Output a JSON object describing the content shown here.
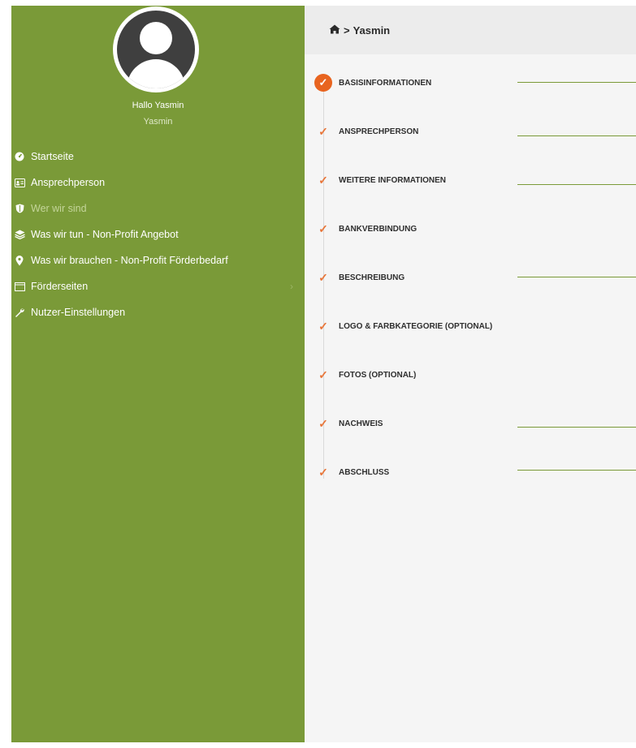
{
  "user": {
    "greeting": "Hallo Yasmin",
    "name": "Yasmin"
  },
  "sidebar": {
    "items": [
      {
        "label": "Startseite",
        "icon": "dashboard-icon"
      },
      {
        "label": "Ansprechperson",
        "icon": "id-card-icon"
      },
      {
        "label": "Wer wir sind",
        "icon": "shield-icon"
      },
      {
        "label": "Was wir tun - Non-Profit Angebot",
        "icon": "layers-icon"
      },
      {
        "label": "Was wir brauchen - Non-Profit Förderbedarf",
        "icon": "map-pin-icon"
      },
      {
        "label": "Förderseiten",
        "icon": "window-icon"
      },
      {
        "label": "Nutzer-Einstellungen",
        "icon": "wrench-icon"
      }
    ]
  },
  "breadcrumb": {
    "home_icon": "home-icon",
    "separator": ">",
    "current": "Yasmin"
  },
  "steps": [
    {
      "label": "BASISINFORMATIONEN",
      "active": true
    },
    {
      "label": "ANSPRECHPERSON",
      "active": false
    },
    {
      "label": "WEITERE INFORMATIONEN",
      "active": false
    },
    {
      "label": "BANKVERBINDUNG",
      "active": false
    },
    {
      "label": "BESCHREIBUNG",
      "active": false
    },
    {
      "label": "LOGO & FARBKATEGORIE (OPTIONAL)",
      "active": false
    },
    {
      "label": "FOTOS (OPTIONAL)",
      "active": false
    },
    {
      "label": "NACHWEIS",
      "active": false
    },
    {
      "label": "ABSCHLUSS",
      "active": false
    }
  ],
  "colors": {
    "sidebar": "#7a9a38",
    "accent": "#e8641f",
    "check": "#e8763a"
  }
}
